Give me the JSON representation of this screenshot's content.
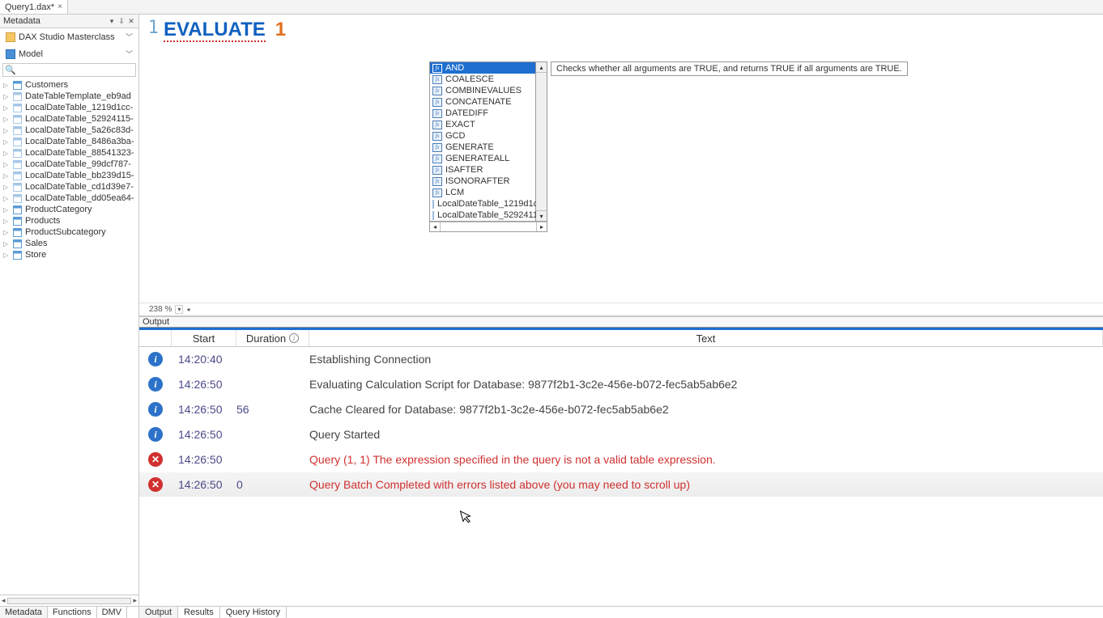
{
  "top_tab": {
    "label": "Query1.dax*",
    "close": "×"
  },
  "sidebar": {
    "title": "Metadata",
    "pin_glyph": "⇩",
    "x_glyph": "✕",
    "db_dropdown": "DAX Studio Masterclass",
    "model_dropdown": "Model",
    "search_placeholder": "",
    "tree": [
      {
        "label": "Customers",
        "light": false
      },
      {
        "label": "DateTableTemplate_eb9ad",
        "light": true
      },
      {
        "label": "LocalDateTable_1219d1cc-",
        "light": true
      },
      {
        "label": "LocalDateTable_52924115-",
        "light": true
      },
      {
        "label": "LocalDateTable_5a26c83d-",
        "light": true
      },
      {
        "label": "LocalDateTable_8486a3ba-",
        "light": true
      },
      {
        "label": "LocalDateTable_88541323-",
        "light": true
      },
      {
        "label": "LocalDateTable_99dcf787-",
        "light": true
      },
      {
        "label": "LocalDateTable_bb239d15-",
        "light": true
      },
      {
        "label": "LocalDateTable_cd1d39e7-",
        "light": true
      },
      {
        "label": "LocalDateTable_dd05ea64-",
        "light": true
      },
      {
        "label": "ProductCategory",
        "light": false
      },
      {
        "label": "Products",
        "light": false
      },
      {
        "label": "ProductSubcategory",
        "light": false
      },
      {
        "label": "Sales",
        "light": false
      },
      {
        "label": "Store",
        "light": false
      }
    ],
    "tabs": [
      "Metadata",
      "Functions",
      "DMV"
    ]
  },
  "editor": {
    "line_number": "1",
    "keyword": "EVALUATE",
    "value": "1",
    "zoom": "238 %"
  },
  "intellisense": {
    "items": [
      {
        "label": "AND",
        "type": "fx",
        "selected": true
      },
      {
        "label": "COALESCE",
        "type": "fx"
      },
      {
        "label": "COMBINEVALUES",
        "type": "fx"
      },
      {
        "label": "CONCATENATE",
        "type": "fx"
      },
      {
        "label": "DATEDIFF",
        "type": "fx"
      },
      {
        "label": "EXACT",
        "type": "fx"
      },
      {
        "label": "GCD",
        "type": "fx"
      },
      {
        "label": "GENERATE",
        "type": "fx"
      },
      {
        "label": "GENERATEALL",
        "type": "fx"
      },
      {
        "label": "ISAFTER",
        "type": "fx"
      },
      {
        "label": "ISONORAFTER",
        "type": "fx"
      },
      {
        "label": "LCM",
        "type": "fx"
      },
      {
        "label": "LocalDateTable_1219d1c",
        "type": "tbl"
      },
      {
        "label": "LocalDateTable_5292411",
        "type": "tbl"
      }
    ],
    "tooltip": "Checks whether all arguments are TRUE, and returns TRUE if all arguments are TRUE."
  },
  "output": {
    "title": "Output",
    "columns": {
      "start": "Start",
      "duration": "Duration",
      "text": "Text"
    },
    "rows": [
      {
        "icon": "info",
        "start": "14:20:40",
        "duration": "",
        "text": "Establishing Connection",
        "error": false
      },
      {
        "icon": "info",
        "start": "14:26:50",
        "duration": "",
        "text": "Evaluating Calculation Script for Database: 9877f2b1-3c2e-456e-b072-fec5ab5ab6e2",
        "error": false
      },
      {
        "icon": "info",
        "start": "14:26:50",
        "duration": "56",
        "text": "Cache Cleared for Database: 9877f2b1-3c2e-456e-b072-fec5ab5ab6e2",
        "error": false
      },
      {
        "icon": "info",
        "start": "14:26:50",
        "duration": "",
        "text": "Query Started",
        "error": false
      },
      {
        "icon": "error",
        "start": "14:26:50",
        "duration": "",
        "text": "Query (1, 1) The expression specified in the query is not a valid table expression.",
        "error": true
      },
      {
        "icon": "error",
        "start": "14:26:50",
        "duration": "0",
        "text": "Query Batch Completed with errors listed above (you may need to scroll up)",
        "error": true,
        "highlight": true
      }
    ],
    "tabs": [
      "Output",
      "Results",
      "Query History"
    ]
  }
}
